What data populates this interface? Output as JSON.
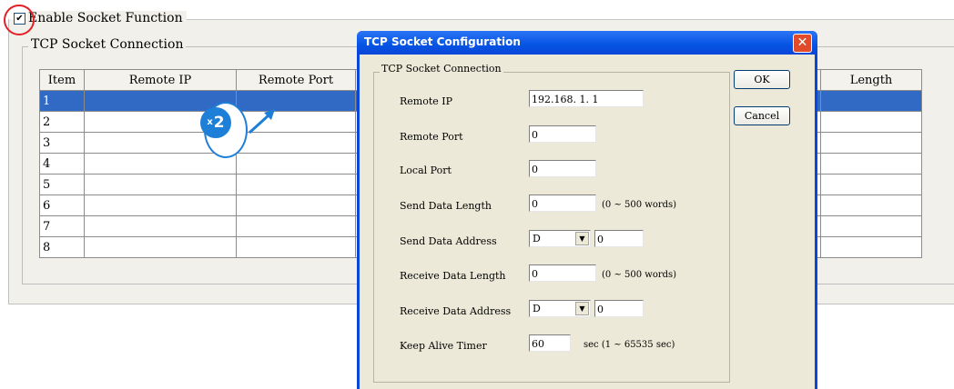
{
  "enable": {
    "label": "Enable Socket Function",
    "checked": true
  },
  "group": {
    "label": "TCP Socket Connection"
  },
  "grid": {
    "headers": {
      "item": "Item",
      "remote_ip": "Remote IP",
      "remote_port": "Remote Port",
      "length": "Length"
    },
    "rows": [
      "1",
      "2",
      "3",
      "4",
      "5",
      "6",
      "7",
      "8"
    ],
    "selected_row": "1"
  },
  "hint": {
    "badge": "2",
    "multiplier": "x"
  },
  "dialog": {
    "title": "TCP Socket Configuration",
    "close": "✕",
    "section": "TCP Socket Connection",
    "ok": "OK",
    "cancel": "Cancel",
    "fields": {
      "remote_ip": {
        "label": "Remote IP",
        "value": "192.168.  1.  1"
      },
      "remote_port": {
        "label": "Remote Port",
        "value": "0"
      },
      "local_port": {
        "label": "Local Port",
        "value": "0"
      },
      "send_len": {
        "label": "Send Data Length",
        "value": "0",
        "note": "(0 ~ 500 words)"
      },
      "send_addr": {
        "label": "Send Data Address",
        "device": "D",
        "value": "0"
      },
      "recv_len": {
        "label": "Receive Data Length",
        "value": "0",
        "note": "(0 ~ 500 words)"
      },
      "recv_addr": {
        "label": "Receive Data Address",
        "device": "D",
        "value": "0"
      },
      "keepalive": {
        "label": "Keep Alive Timer",
        "value": "60",
        "note": "sec (1 ~ 65535 sec)"
      }
    }
  },
  "colors": {
    "selection": "#316ac5",
    "accent": "#1e7fd8",
    "highlight_ring": "#e41e26",
    "title_bar": "#0a46d8"
  }
}
